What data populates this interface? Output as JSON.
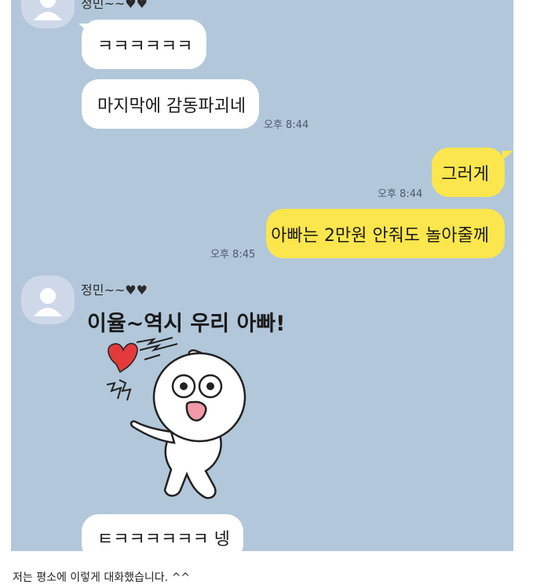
{
  "chat": {
    "sender_name_top": "정민~~♥♥",
    "sender_name": "정민~~♥♥",
    "messages": [
      {
        "text": "ㅋㅋㅋㅋㅋㅋ"
      },
      {
        "text": "마지막에 감동파괴네",
        "time": "오후 8:44"
      },
      {
        "text": "그러게",
        "time": "오후 8:44"
      },
      {
        "text": "아빠는 2만원 안줘도 놀아줄께",
        "time": "오후 8:45"
      },
      {
        "text": "이율~역시 우리 아빠!"
      },
      {
        "text": "ㅌㅋㅋㅋㅋㅋㅋ 넹"
      }
    ],
    "sticker": {
      "icon": "cartoon-character-sticker"
    }
  },
  "caption": "저는 평소에 이렇게 대화했습니다. ^^",
  "colors": {
    "chat_background": "#b2c7da",
    "outgoing_bubble": "#fbe64d",
    "incoming_bubble": "#ffffff",
    "heart": "#e33b3b"
  }
}
